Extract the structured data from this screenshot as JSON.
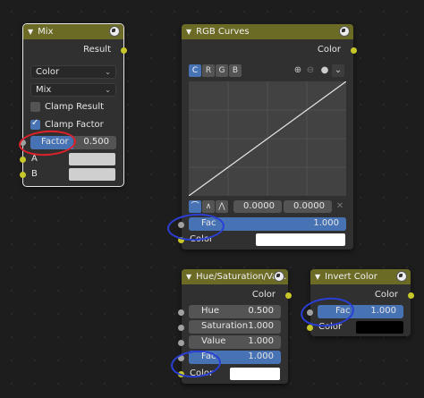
{
  "mix": {
    "title": "Mix",
    "output": "Result",
    "data_type": "Color",
    "blend_mode": "Mix",
    "clamp_result": "Clamp Result",
    "clamp_factor": "Clamp Factor",
    "factor_label": "Factor",
    "factor_value": "0.500",
    "a_label": "A",
    "b_label": "B"
  },
  "rgb_curves": {
    "title": "RGB Curves",
    "output": "Color",
    "channels": [
      "C",
      "R",
      "G",
      "B"
    ],
    "x_value": "0.0000",
    "y_value": "0.0000",
    "fac_label": "Fac",
    "fac_value": "1.000",
    "color_label": "Color"
  },
  "hue_sat": {
    "title": "Hue/Saturation/Va…",
    "output": "Color",
    "hue_label": "Hue",
    "hue_value": "0.500",
    "saturation_label": "Saturation",
    "saturation_value": "1.000",
    "value_label": "Value",
    "value_value": "1.000",
    "fac_label": "Fac",
    "fac_value": "1.000",
    "color_label": "Color"
  },
  "invert": {
    "title": "Invert Color",
    "output": "Color",
    "fac_label": "Fac",
    "fac_value": "1.000",
    "color_label": "Color"
  },
  "colors": {
    "header": "#6b6b26",
    "accent": "#4772b3",
    "socket_color": "#c7c729",
    "socket_float": "#a1a1a1",
    "annotation_blue": "#2a3fd4",
    "annotation_red": "#e0202a"
  }
}
